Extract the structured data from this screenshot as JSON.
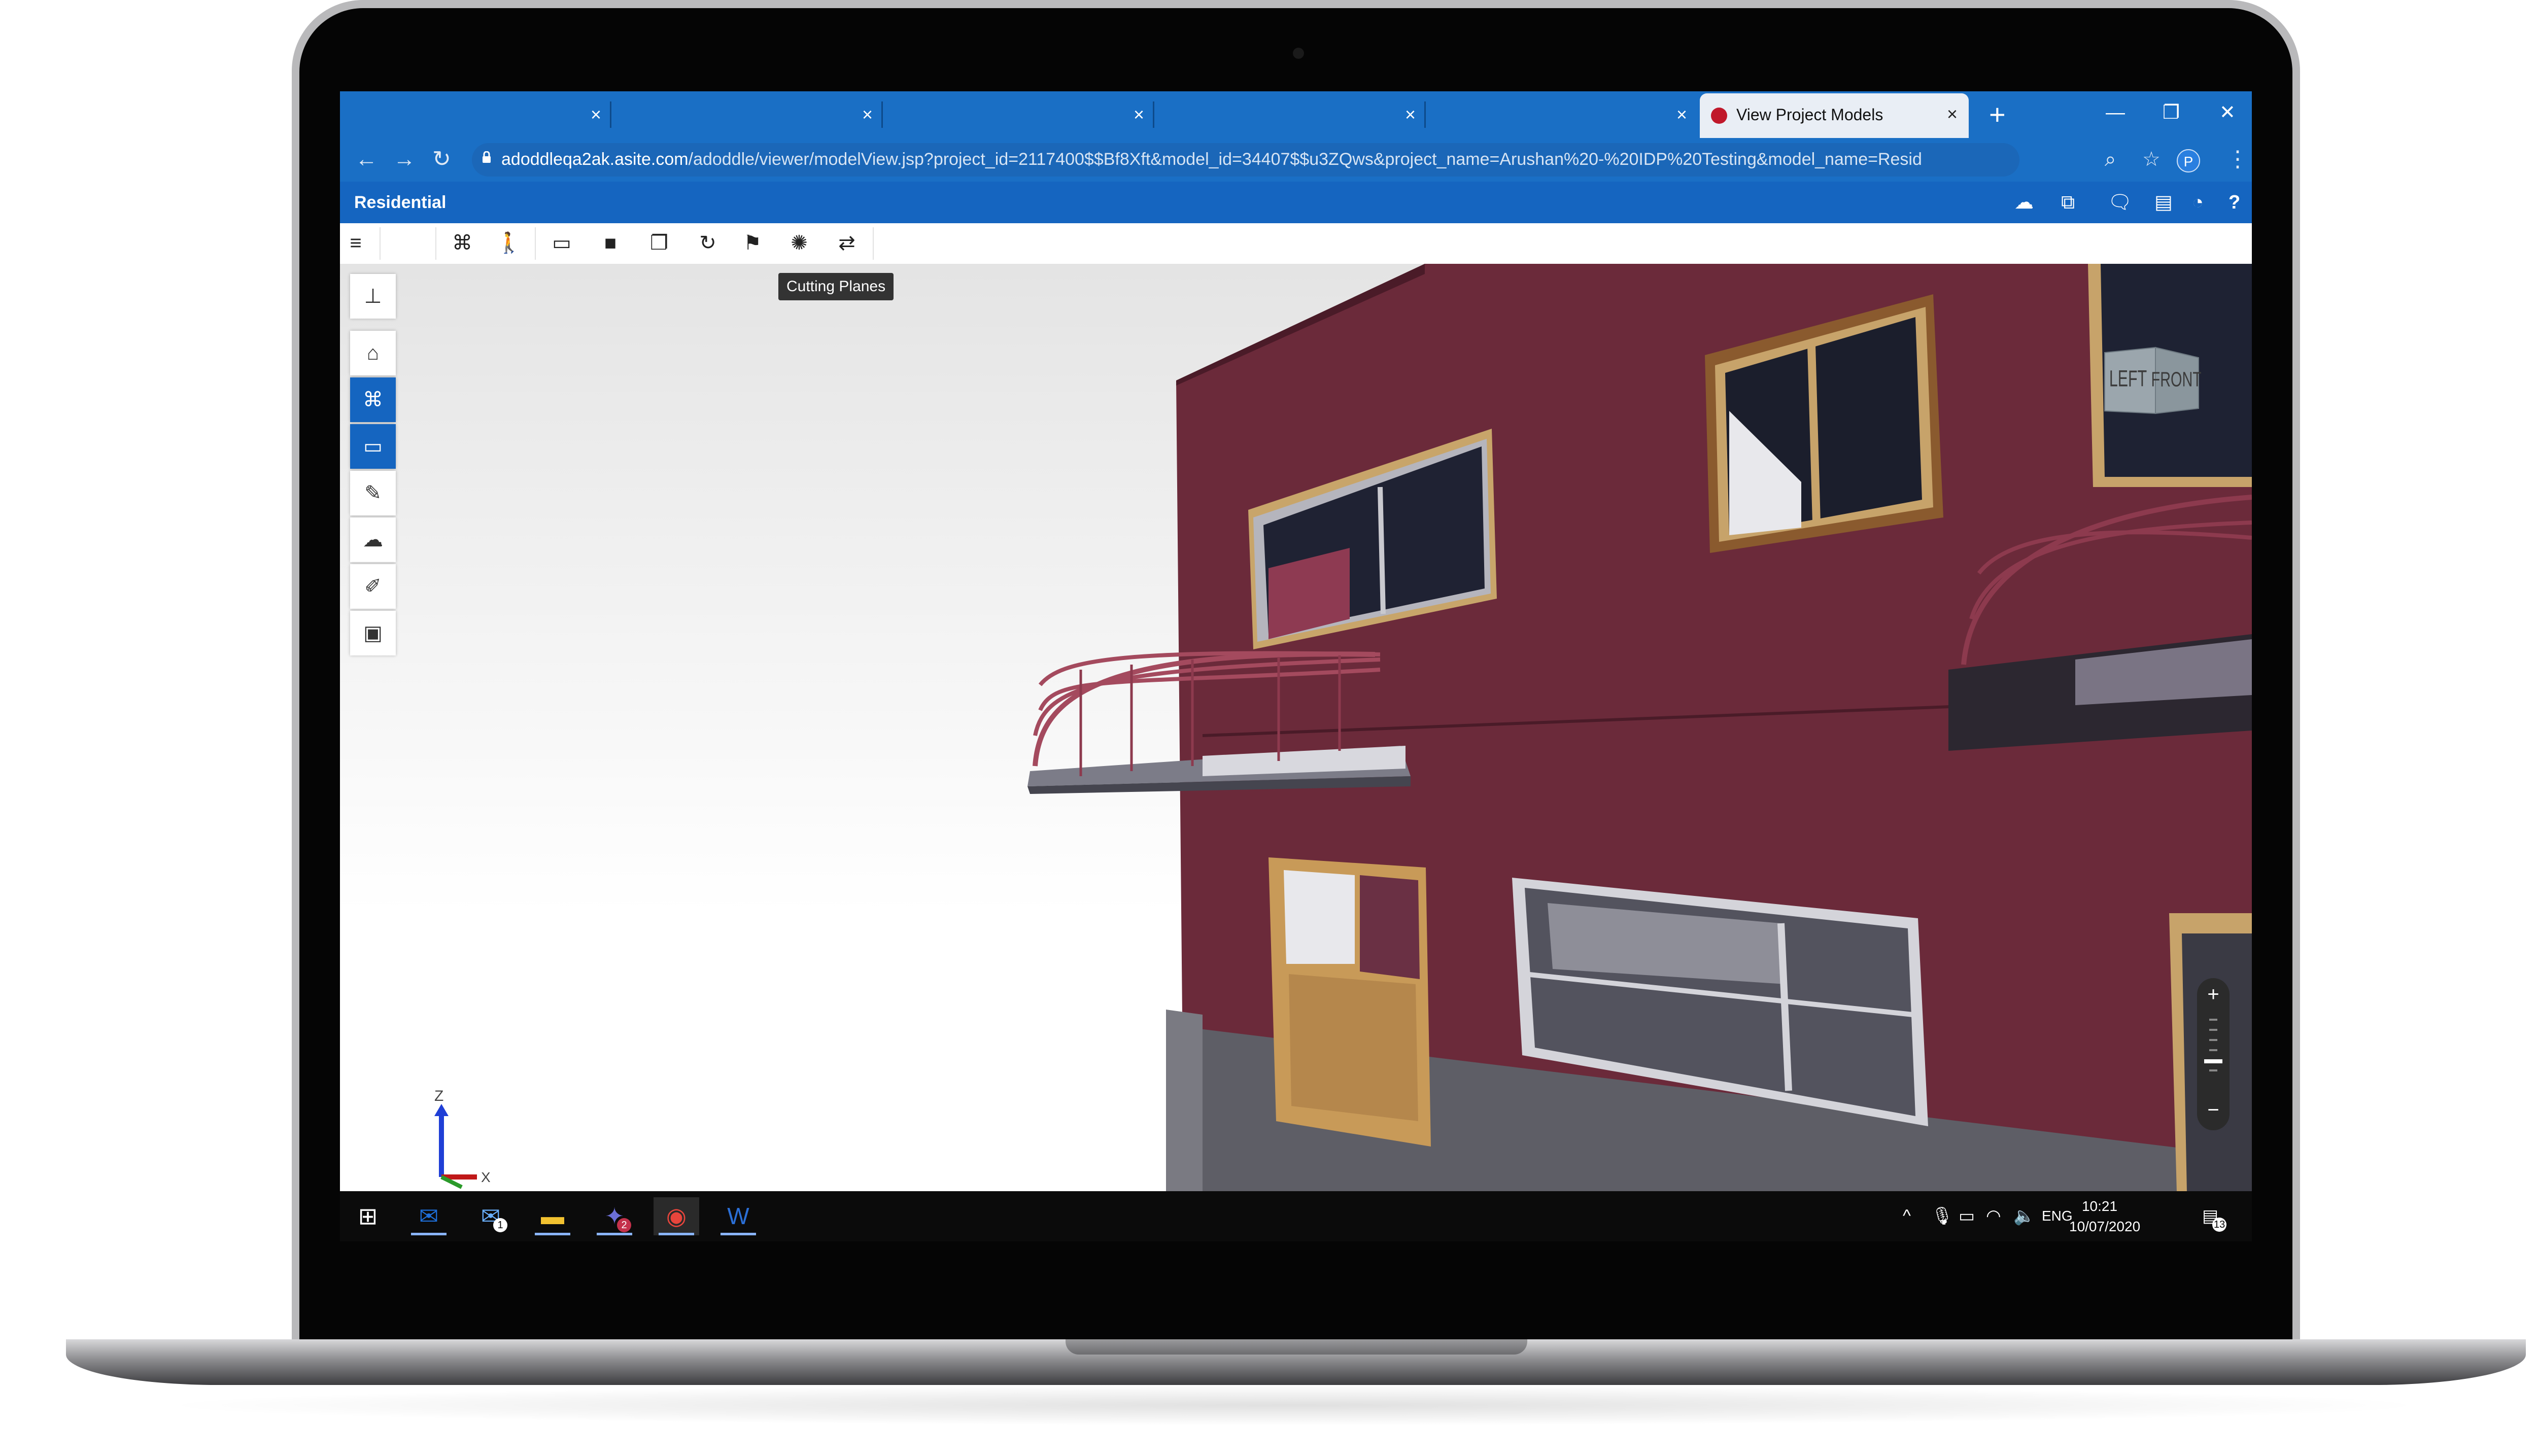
{
  "browser": {
    "tabs": [
      {
        "label": ""
      },
      {
        "label": ""
      },
      {
        "label": ""
      },
      {
        "label": ""
      },
      {
        "label": ""
      }
    ],
    "active_tab": {
      "label": "View Project Models"
    },
    "close_glyph": "×",
    "new_tab_glyph": "+",
    "window_controls": {
      "minimize": "—",
      "restore": "❐",
      "close": "✕"
    },
    "url_domain": "adoddleqa2ak.asite.com",
    "url_path": "/adoddle/viewer/modelView.jsp?project_id=2117400$$Bf8Xft&model_id=34407$$u3ZQws&project_name=Arushan%20-%20IDP%20Testing&model_name=Residential&toOpe...",
    "profile_initial": "P"
  },
  "app": {
    "title": "Residential",
    "header_icons": [
      "models-icon",
      "compare-icon",
      "chat-icon",
      "report-icon",
      "history-icon",
      "help-icon"
    ],
    "help_label": "?"
  },
  "toolbar": {
    "menu_glyph": "≡",
    "tooltip": "Cutting Planes"
  },
  "viewcube": {
    "left": "LEFT",
    "front": "FRONT"
  },
  "axes": {
    "z": "Z",
    "x": "X"
  },
  "zoom": {
    "plus": "+",
    "minus": "−"
  },
  "taskbar": {
    "mail_badge": "1",
    "teams_badge": "2",
    "language": "ENG",
    "time": "10:21",
    "date": "10/07/2020",
    "notifications_badge": "13"
  },
  "colors": {
    "chrome_blue": "#1a6fc5",
    "app_blue": "#1565c0",
    "wall": "#6b2a3a"
  }
}
